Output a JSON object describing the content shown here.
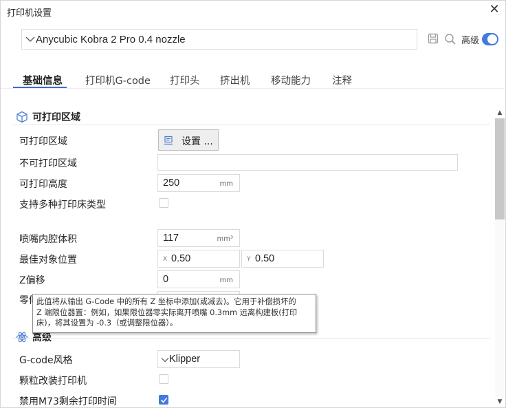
{
  "window": {
    "title": "打印机设置"
  },
  "preset": {
    "name": "Anycubic Kobra 2 Pro 0.4 nozzle",
    "advanced_label": "高级"
  },
  "tabs": [
    "基础信息",
    "打印机G-code",
    "打印头",
    "挤出机",
    "移动能力",
    "注释"
  ],
  "sections": {
    "printable": "可打印区域",
    "advanced": "高级"
  },
  "rows": {
    "printable_area": {
      "label": "可打印区域",
      "button": "设置 ..."
    },
    "excluded_area": {
      "label": "不可打印区域",
      "value": ""
    },
    "printable_height": {
      "label": "可打印高度",
      "value": "250",
      "unit": "mm"
    },
    "multi_bed": {
      "label": "支持多种打印床类型"
    },
    "nozzle_volume": {
      "label": "喷嘴内腔体积",
      "value": "117",
      "unit": "mm³"
    },
    "best_position": {
      "label": "最佳对象位置",
      "x_axis": "X",
      "x_value": "0.50",
      "y_axis": "Y",
      "y_value": "0.50"
    },
    "z_offset": {
      "label": "Z偏移",
      "value": "0",
      "unit": "mm"
    },
    "zero_partial": {
      "label": "零倾"
    },
    "gcode_flavor": {
      "label": "G-code风格",
      "value": "Klipper"
    },
    "pellet": {
      "label": "颗粒改装打印机"
    },
    "m73": {
      "label": "禁用M73剩余打印时间"
    }
  },
  "tooltip": {
    "text": "此值将从输出 G-Code 中的所有 Z 坐标中添加(或减去)。它用于补偿损坏的\nZ 端限位器置：例如，如果限位器零实际离开喷嘴 0.3mm 远离构建板(打印\n床)，将其设置为 -0.3（或调整限位器）。"
  },
  "colors": {
    "accent": "#4479e0",
    "tab_underline": "#3a6bd1"
  }
}
